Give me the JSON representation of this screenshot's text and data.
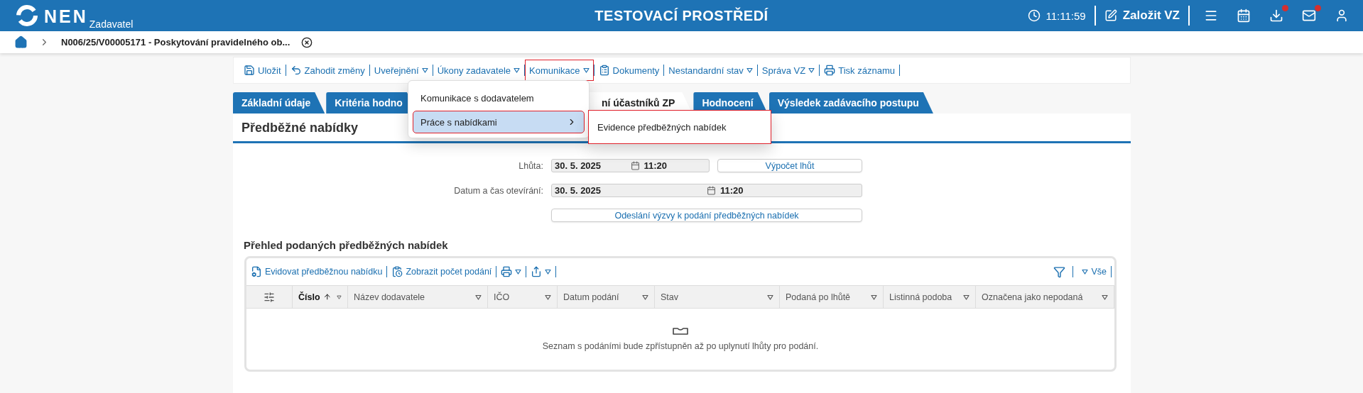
{
  "header": {
    "logo": "NEN",
    "subtitle": "Zadavatel",
    "title": "TESTOVACÍ PROSTŘEDÍ",
    "time": "11:11:59",
    "create_button": "Založit VZ",
    "icons": [
      {
        "kind": "menu",
        "badge": false
      },
      {
        "kind": "calendar",
        "badge": false
      },
      {
        "kind": "download",
        "badge": true
      },
      {
        "kind": "mail",
        "badge": true
      },
      {
        "kind": "user",
        "badge": false
      }
    ]
  },
  "breadcrumb": {
    "title": "N006/25/V00005171 - Poskytování pravidelného ob..."
  },
  "toolbar": [
    {
      "label": "Uložit",
      "kind": "save",
      "highlighted": false
    },
    {
      "label": "Zahodit změny",
      "kind": "undo",
      "highlighted": false
    },
    {
      "label": "Uveřejnění",
      "kind": "dropdown",
      "highlighted": false
    },
    {
      "label": "Úkony zadavatele",
      "kind": "dropdown",
      "highlighted": false
    },
    {
      "label": "Komunikace",
      "kind": "dropdown",
      "highlighted": true
    },
    {
      "label": "Dokumenty",
      "kind": "documents",
      "highlighted": false
    },
    {
      "label": "Nestandardní stav",
      "kind": "dropdown",
      "highlighted": false
    },
    {
      "label": "Správa VZ",
      "kind": "dropdown",
      "highlighted": false
    },
    {
      "label": "Tisk záznamu",
      "kind": "print",
      "highlighted": false
    }
  ],
  "menu": {
    "items": [
      {
        "label": "Komunikace s dodavatelem",
        "selected": false,
        "highlighted": false,
        "submenu": false
      },
      {
        "label": "Práce s nabídkami",
        "selected": true,
        "highlighted": true,
        "submenu": true
      }
    ],
    "submenu": {
      "highlighted": true,
      "items": [
        {
          "label": "Evidence předběžných nabídek"
        }
      ]
    }
  },
  "tabs": [
    {
      "label": "Základní údaje",
      "selected": false
    },
    {
      "label": "Kritéria hodno",
      "selected": false
    },
    {
      "label": "ní účastníků ZP",
      "selected": true
    },
    {
      "label": "Hodnocení",
      "selected": false
    },
    {
      "label": "Výsledek zadávacího postupu",
      "selected": false
    }
  ],
  "section_title": "Předběžné nabídky",
  "form": {
    "rows": [
      {
        "label": "Lhůta:",
        "date": "30. 5. 2025",
        "time": "11:20",
        "button": "Výpočet lhůt"
      },
      {
        "label": "Datum a čas otevírání:",
        "date": "30. 5. 2025",
        "time": "11:20"
      }
    ],
    "send_button": "Odeslání výzvy k podání předběžných nabídek"
  },
  "table": {
    "title": "Přehled podaných předběžných nabídek",
    "actions": [
      {
        "kind": "register",
        "label": "Evidovat předběžnou nabídku"
      },
      {
        "kind": "count",
        "label": "Zobrazit počet podání"
      },
      {
        "kind": "print"
      },
      {
        "kind": "export"
      }
    ],
    "filter_label": "Vše",
    "columns": [
      {
        "label": "Číslo",
        "sorted": true
      },
      {
        "label": "Název dodavatele",
        "sorted": false
      },
      {
        "label": "IČO",
        "sorted": false
      },
      {
        "label": "Datum podání",
        "sorted": false
      },
      {
        "label": "Stav",
        "sorted": false
      },
      {
        "label": "Podaná po lhůtě",
        "sorted": false
      },
      {
        "label": "Listinná podoba",
        "sorted": false
      },
      {
        "label": "Označena jako nepodaná",
        "sorted": false
      }
    ],
    "empty_message": "Seznam s podáními bude zpřístupněn až po uplynutí lhůty pro podání."
  }
}
